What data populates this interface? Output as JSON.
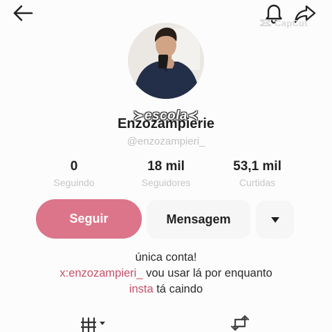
{
  "header": {
    "back_icon": "arrow-left-icon",
    "notification_icon": "bell-icon",
    "share_icon": "share-arrow-icon"
  },
  "watermark": {
    "text": "CapCut"
  },
  "profile": {
    "overlay_text": "≻escola≺",
    "display_name": "Enzozampierie",
    "username": "@enzozampieri_"
  },
  "stats": [
    {
      "value": "0",
      "label": "Seguindo"
    },
    {
      "value": "18 mil",
      "label": "Seguidores"
    },
    {
      "value": "53,1 mil",
      "label": "Curtidas"
    }
  ],
  "actions": {
    "follow_label": "Seguir",
    "message_label": "Mensagem",
    "more_icon": "caret-down-icon"
  },
  "bio": {
    "line1": "única conta!",
    "line2_link": "x:enzozampieri_",
    "line2_rest": " vou usar lá por enquanto",
    "line3_link": "insta",
    "line3_rest": " tá caindo"
  },
  "colors": {
    "follow_button": "#dc758a",
    "link": "#c7506a",
    "secondary_button": "#f6f6f6",
    "muted_text": "#c6c6c6"
  }
}
